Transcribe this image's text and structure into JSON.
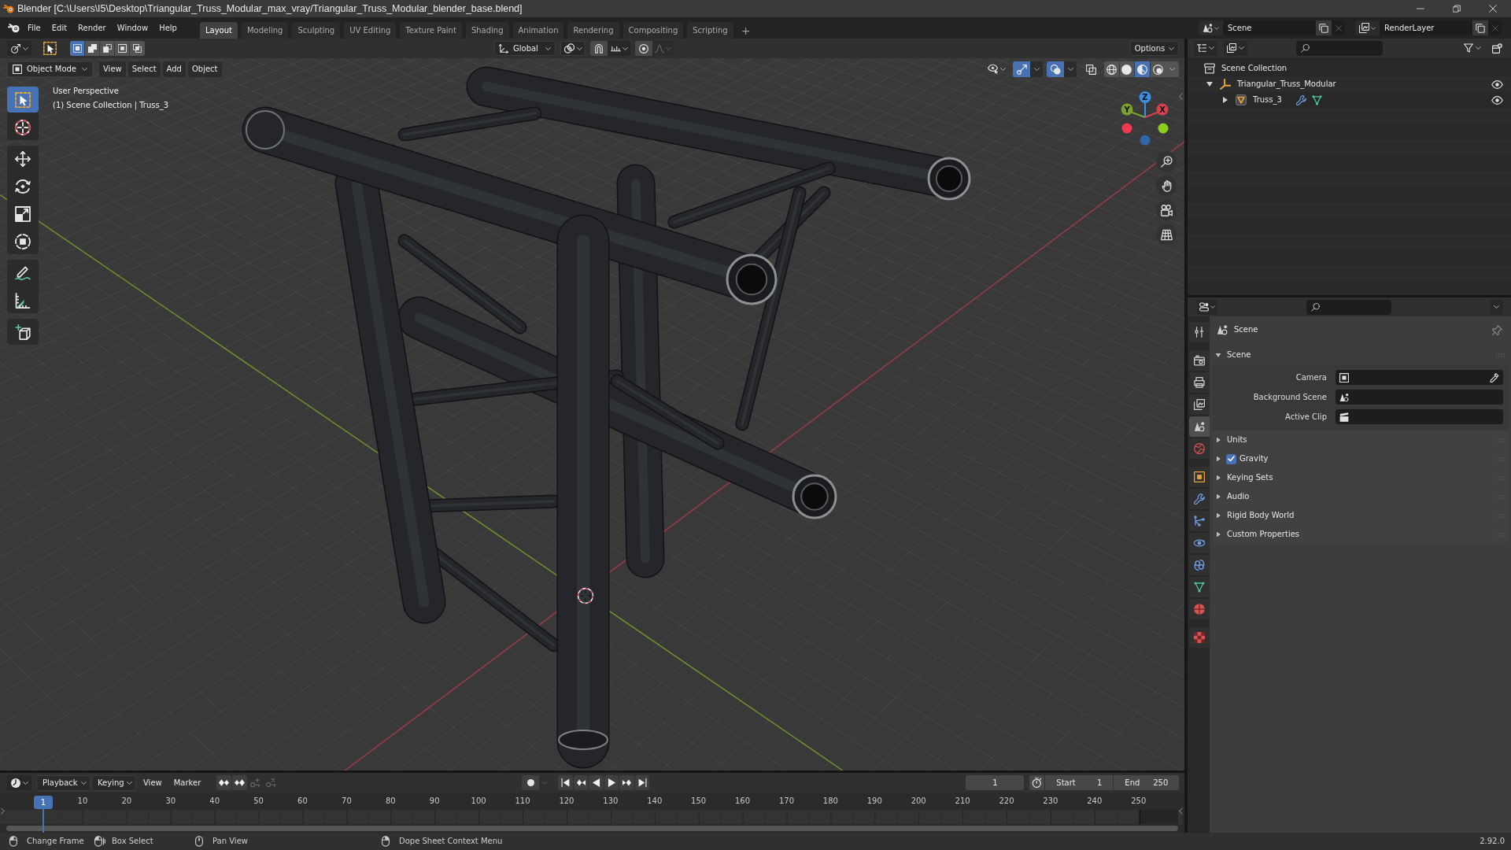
{
  "window": {
    "title": "Blender [C:\\Users\\I5\\Desktop\\Triangular_Truss_Modular_max_vray/Triangular_Truss_Modular_blender_base.blend]"
  },
  "topbar": {
    "menus": [
      "File",
      "Edit",
      "Render",
      "Window",
      "Help"
    ],
    "workspaces": [
      {
        "label": "Layout",
        "selected": true
      },
      {
        "label": "Modeling",
        "selected": false
      },
      {
        "label": "Sculpting",
        "selected": false
      },
      {
        "label": "UV Editing",
        "selected": false
      },
      {
        "label": "Texture Paint",
        "selected": false
      },
      {
        "label": "Shading",
        "selected": false
      },
      {
        "label": "Animation",
        "selected": false
      },
      {
        "label": "Rendering",
        "selected": false
      },
      {
        "label": "Compositing",
        "selected": false
      },
      {
        "label": "Scripting",
        "selected": false
      }
    ],
    "add_workspace": "+",
    "scene": "Scene",
    "view_layer": "RenderLayer"
  },
  "viewport": {
    "tool_settings": {
      "select_modes": [
        {
          "kind": "set",
          "selected": true
        },
        {
          "kind": "extend",
          "selected": false
        },
        {
          "kind": "subtract",
          "selected": false
        },
        {
          "kind": "invert",
          "selected": false
        },
        {
          "kind": "intersect",
          "selected": false
        }
      ],
      "orientation": "Global",
      "snapping": {
        "on": false
      },
      "proportional": {
        "on": false
      },
      "options": "Options"
    },
    "header": {
      "mode": "Object Mode",
      "menus": [
        "View",
        "Select",
        "Add",
        "Object"
      ],
      "toggles": [
        {
          "kind": "gizmos",
          "on": true
        },
        {
          "kind": "overlays",
          "on": true
        },
        {
          "kind": "xray",
          "on": false
        }
      ],
      "shading": [
        {
          "kind": "wireframe",
          "selected": false
        },
        {
          "kind": "solid",
          "selected": false
        },
        {
          "kind": "material",
          "selected": true
        },
        {
          "kind": "rendered",
          "selected": false
        }
      ]
    },
    "toolbar": [
      {
        "tools": [
          {
            "kind": "select_box",
            "selected": true
          },
          {
            "kind": "cursor",
            "selected": false
          }
        ]
      },
      {
        "tools": [
          {
            "kind": "move",
            "selected": false
          },
          {
            "kind": "rotate",
            "selected": false
          },
          {
            "kind": "scale",
            "selected": false
          },
          {
            "kind": "transform",
            "selected": false
          }
        ]
      },
      {
        "tools": [
          {
            "kind": "annotate",
            "selected": false
          },
          {
            "kind": "measure",
            "selected": false
          }
        ]
      },
      {
        "tools": [
          {
            "kind": "add_cube",
            "selected": false
          }
        ]
      }
    ],
    "info": [
      "User Perspective",
      "(1) Scene Collection | Truss_3"
    ],
    "gizmo": {
      "x": "X",
      "y": "Y",
      "z": "Z"
    }
  },
  "outliner": {
    "tree": [
      {
        "label": "Scene Collection",
        "kind": "scene_collection",
        "children": [
          {
            "label": "Triangular_Truss_Modular",
            "kind": "empty",
            "expanded": true,
            "visible": true,
            "children": [
              {
                "label": "Truss_3",
                "kind": "mesh",
                "expanded": false,
                "visible": true,
                "extras": [
                  {
                    "kind": "modifier"
                  },
                  {
                    "kind": "mesh_data"
                  }
                ]
              }
            ]
          }
        ]
      }
    ]
  },
  "properties": {
    "tab_groups": [
      {
        "tabs": [
          {
            "kind": "tool",
            "selected": false
          }
        ]
      },
      {
        "tabs": [
          {
            "kind": "render",
            "selected": false
          },
          {
            "kind": "output",
            "selected": false
          },
          {
            "kind": "view_layer",
            "selected": false
          },
          {
            "kind": "scene",
            "selected": true
          },
          {
            "kind": "world",
            "selected": false
          }
        ]
      },
      {
        "tabs": [
          {
            "kind": "object",
            "selected": false
          },
          {
            "kind": "modifiers",
            "selected": false
          },
          {
            "kind": "particles",
            "selected": false
          },
          {
            "kind": "physics",
            "selected": false
          },
          {
            "kind": "constraints",
            "selected": false
          },
          {
            "kind": "data",
            "selected": false
          },
          {
            "kind": "material",
            "selected": false
          }
        ]
      },
      {
        "tabs": [
          {
            "kind": "texture",
            "selected": false
          }
        ]
      }
    ],
    "context": "Scene",
    "panels": [
      {
        "title": "Scene",
        "expanded": true,
        "fields": [
          {
            "label": "Camera",
            "kind": "object"
          },
          {
            "label": "Background Scene",
            "kind": "scene"
          },
          {
            "label": "Active Clip",
            "kind": "clip"
          }
        ]
      },
      {
        "title": "Units",
        "expanded": false
      },
      {
        "title": "Gravity",
        "expanded": false,
        "toggle": {
          "checked": true
        }
      },
      {
        "title": "Keying Sets",
        "expanded": false
      },
      {
        "title": "Audio",
        "expanded": false
      },
      {
        "title": "Rigid Body World",
        "expanded": false
      },
      {
        "title": "Custom Properties",
        "expanded": false
      }
    ]
  },
  "timeline": {
    "menus": [
      {
        "label": "Playback",
        "dropdown": true
      },
      {
        "label": "Keying",
        "dropdown": true
      },
      {
        "label": "View",
        "dropdown": false
      },
      {
        "label": "Marker",
        "dropdown": false
      }
    ],
    "key_buttons": [
      {
        "kind": "prev",
        "disabled": false
      },
      {
        "kind": "next",
        "disabled": false
      },
      {
        "kind": "insert",
        "disabled": true
      },
      {
        "kind": "delete",
        "disabled": true
      }
    ],
    "current_frame": "1",
    "start": {
      "label": "Start",
      "value": "1"
    },
    "end": {
      "label": "End",
      "value": "250"
    },
    "ruler": [
      "10",
      "20",
      "30",
      "40",
      "50",
      "60",
      "70",
      "80",
      "90",
      "100",
      "110",
      "120",
      "130",
      "140",
      "150",
      "160",
      "170",
      "180",
      "190",
      "200",
      "210",
      "220",
      "230",
      "240",
      "250"
    ],
    "playhead": "1"
  },
  "status_bar": {
    "hints": [
      {
        "kind": "mouse_left",
        "label": "Change Frame"
      },
      {
        "kind": "mouse_drag",
        "label": "Box Select"
      },
      {
        "kind": "mouse_middle",
        "label": "Pan View"
      },
      {
        "kind": "mouse_right",
        "label": "Dope Sheet Context Menu"
      }
    ],
    "version": "2.92.0"
  }
}
